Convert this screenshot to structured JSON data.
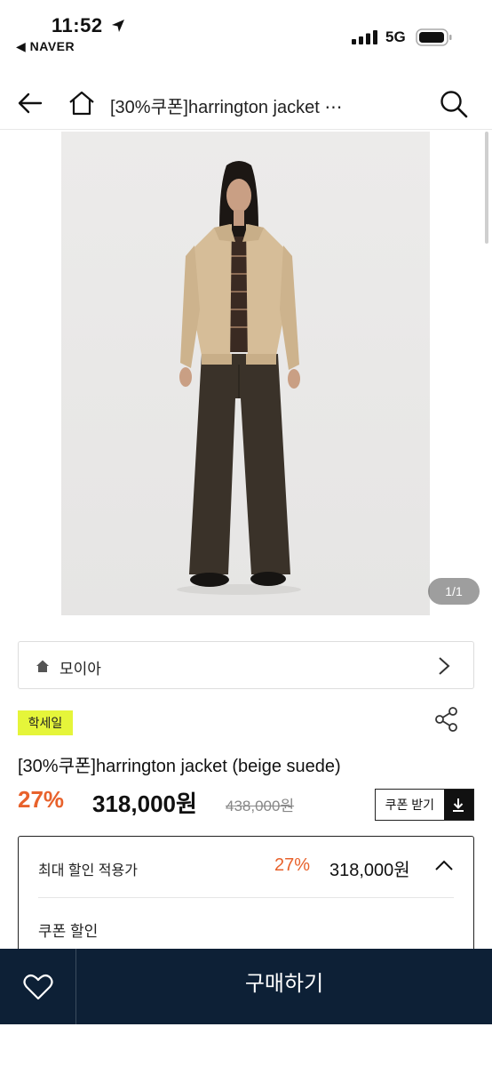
{
  "status_bar": {
    "time": "11:52",
    "back_app": "◀ NAVER",
    "network": "5G"
  },
  "nav": {
    "title": "[30%쿠폰]harrington jacket ⋯"
  },
  "gallery": {
    "counter": "1/1"
  },
  "brand": {
    "name": "모이아"
  },
  "product": {
    "tag": "학세일",
    "title": "[30%쿠폰]harrington jacket (beige suede)",
    "discount_rate": "27%",
    "sale_price": "318,000원",
    "original_price": "438,000원",
    "coupon_button": "쿠폰 받기"
  },
  "discount_panel": {
    "label": "최대 할인 적용가",
    "rate": "27%",
    "price": "318,000원",
    "coupon_label": "쿠폰 할인"
  },
  "bottom_bar": {
    "buy_label": "구매하기"
  },
  "colors": {
    "accent_orange": "#e8622c",
    "tag_yellow": "#e5f53a",
    "bottom_bar": "#0d2036"
  }
}
